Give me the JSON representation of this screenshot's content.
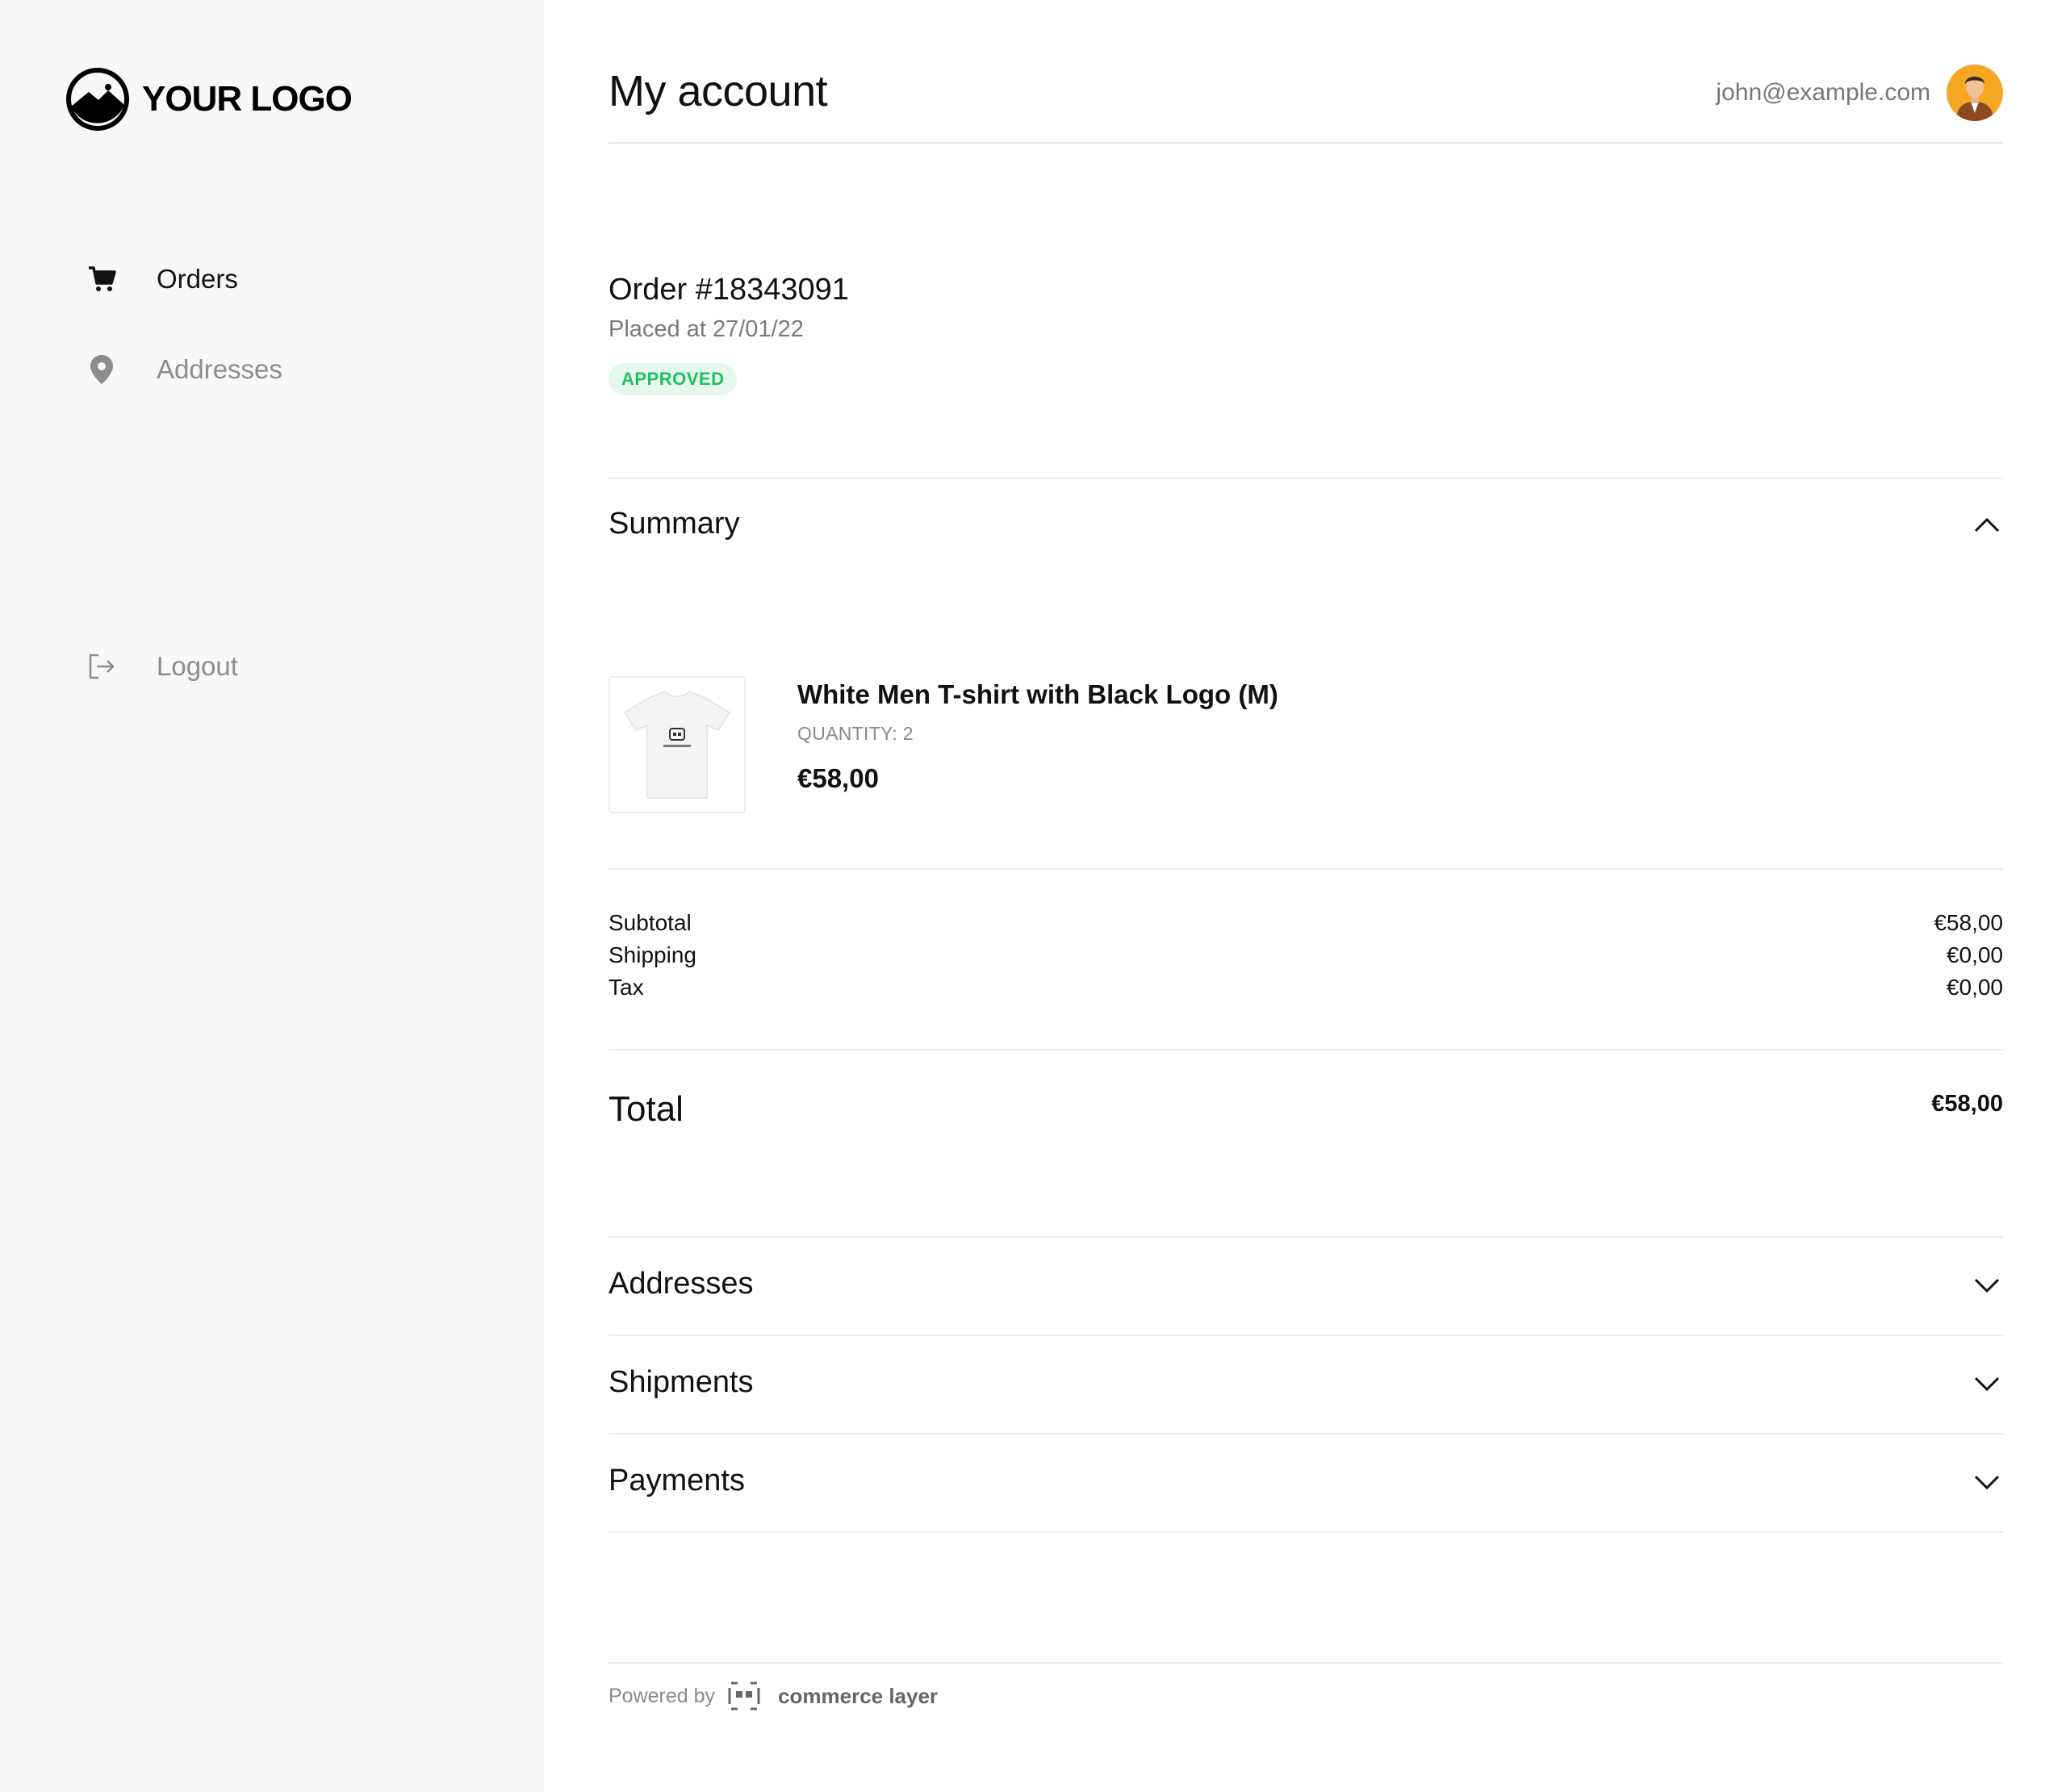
{
  "brand": {
    "logo_text": "YOUR LOGO"
  },
  "sidebar": {
    "items": [
      {
        "label": "Orders",
        "icon": "cart-icon",
        "active": true
      },
      {
        "label": "Addresses",
        "icon": "map-pin-icon",
        "active": false
      }
    ],
    "logout_label": "Logout"
  },
  "header": {
    "title": "My account",
    "email": "john@example.com"
  },
  "order": {
    "title": "Order #18343091",
    "placed": "Placed at 27/01/22",
    "status": "APPROVED",
    "status_color": "#1fbf62"
  },
  "summary": {
    "title": "Summary",
    "item": {
      "name": "White Men T-shirt with Black Logo (M)",
      "quantity": "QUANTITY: 2",
      "price": "€58,00"
    },
    "rows": [
      {
        "label": "Subtotal",
        "value": "€58,00"
      },
      {
        "label": "Shipping",
        "value": "€0,00"
      },
      {
        "label": "Tax",
        "value": "€0,00"
      }
    ],
    "total_label": "Total",
    "total_value": "€58,00"
  },
  "sections": {
    "addresses": "Addresses",
    "shipments": "Shipments",
    "payments": "Payments"
  },
  "footer": {
    "powered_by": "Powered by",
    "provider": "commerce layer"
  }
}
